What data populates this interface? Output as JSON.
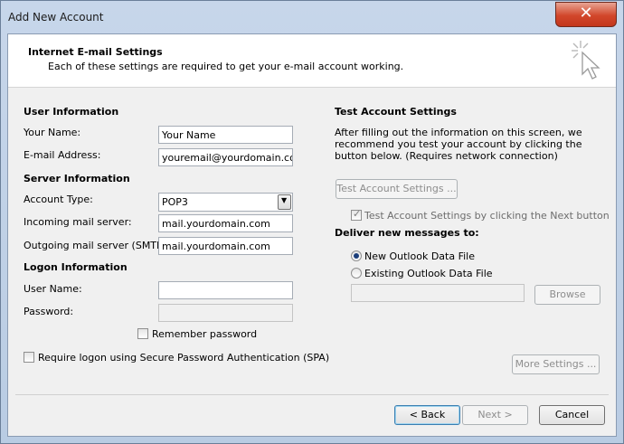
{
  "window": {
    "title": "Add New Account",
    "close_glyph": "✕"
  },
  "header": {
    "title": "Internet E-mail Settings",
    "subtitle": "Each of these settings are required to get your e-mail account working.",
    "icon": "cursor-sparkle-icon"
  },
  "user_info": {
    "heading": "User Information",
    "name_label": "Your Name:",
    "name_value": "Your Name",
    "email_label": "E-mail Address:",
    "email_value": "youremail@yourdomain.com"
  },
  "server_info": {
    "heading": "Server Information",
    "account_type_label": "Account Type:",
    "account_type_value": "POP3",
    "incoming_label": "Incoming mail server:",
    "incoming_value": "mail.yourdomain.com",
    "outgoing_label": "Outgoing mail server (SMTP):",
    "outgoing_value": "mail.yourdomain.com"
  },
  "logon_info": {
    "heading": "Logon Information",
    "username_label": "User Name:",
    "username_value": "",
    "password_label": "Password:",
    "password_value": "",
    "remember_label": "Remember password",
    "spa_label": "Require logon using Secure Password Authentication (SPA)"
  },
  "test": {
    "heading": "Test Account Settings",
    "description": "After filling out the information on this screen, we recommend you test your account by clicking the button below. (Requires network connection)",
    "button_label": "Test Account Settings ...",
    "auto_test_label": "Test Account Settings by clicking the Next button"
  },
  "deliver": {
    "heading": "Deliver new messages to:",
    "new_file_label": "New Outlook Data File",
    "existing_file_label": "Existing Outlook Data File",
    "path_value": "",
    "browse_label": "Browse"
  },
  "footer": {
    "more_settings_label": "More Settings ...",
    "back_label": "< Back",
    "next_label": "Next >",
    "cancel_label": "Cancel"
  }
}
